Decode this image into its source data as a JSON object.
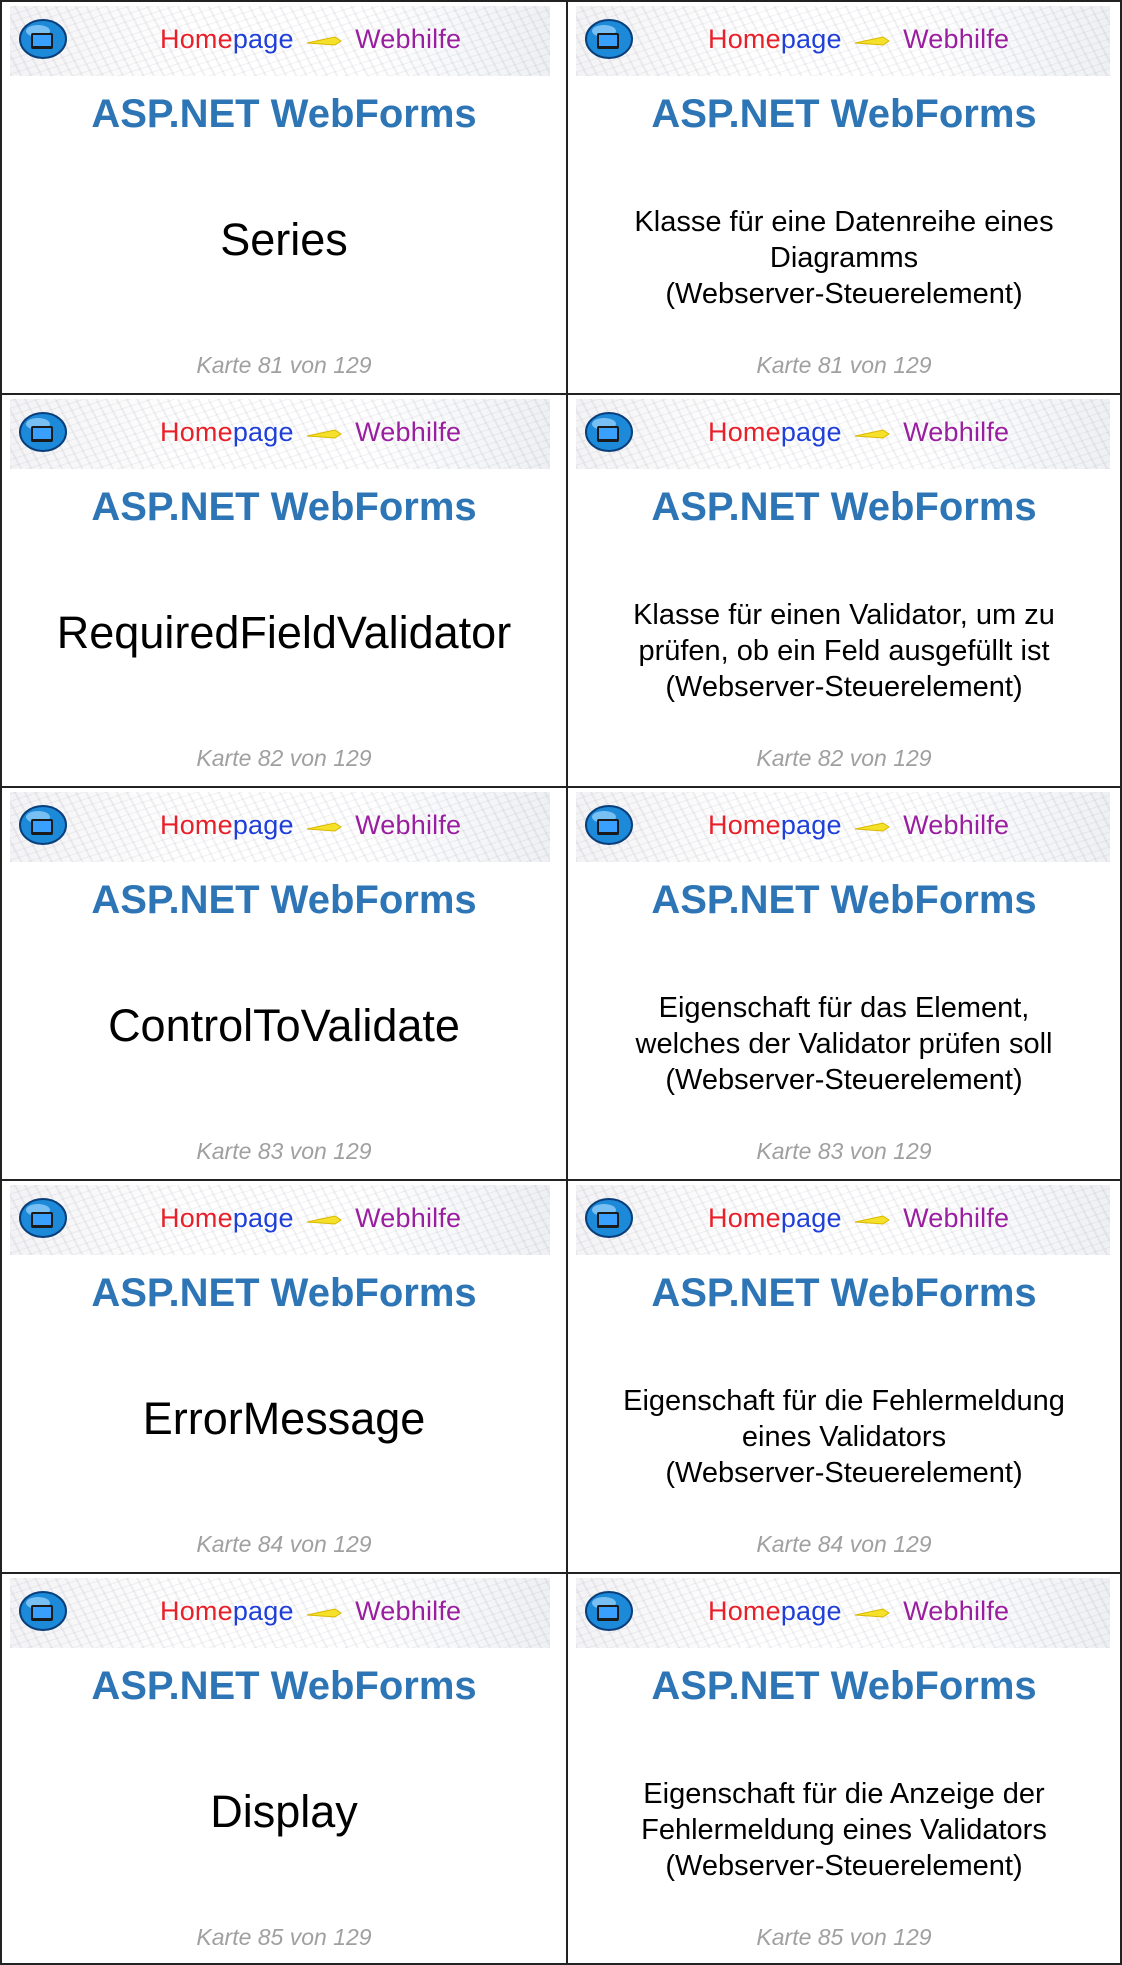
{
  "header": {
    "brand_home": "Home",
    "brand_page": "page",
    "brand_web": "Webhilfe",
    "title": "ASP.NET WebForms"
  },
  "colors": {
    "title": "#2e75b6",
    "brand_red": "#e8202a",
    "brand_blue": "#1f3fd8",
    "brand_purple": "#9a1fa0",
    "footer": "#a0a0a0"
  },
  "cards": [
    {
      "term": "Series",
      "definition": [
        "Klasse für eine Datenreihe eines",
        "Diagramms",
        "(Webserver-Steuerelement)"
      ],
      "footer": "Karte 81 von 129"
    },
    {
      "term": "RequiredFieldValidator",
      "definition": [
        "Klasse für einen Validator, um zu",
        "prüfen, ob ein Feld ausgefüllt ist",
        "(Webserver-Steuerelement)"
      ],
      "footer": "Karte 82 von 129"
    },
    {
      "term": "ControlToValidate",
      "definition": [
        "Eigenschaft für das Element,",
        "welches der Validator prüfen soll",
        "(Webserver-Steuerelement)"
      ],
      "footer": "Karte 83 von 129"
    },
    {
      "term": "ErrorMessage",
      "definition": [
        "Eigenschaft für die Fehlermeldung",
        "eines Validators",
        "(Webserver-Steuerelement)"
      ],
      "footer": "Karte 84 von 129"
    },
    {
      "term": "Display",
      "definition": [
        "Eigenschaft für die Anzeige der",
        "Fehlermeldung eines Validators",
        "(Webserver-Steuerelement)"
      ],
      "footer": "Karte 85 von 129"
    }
  ]
}
